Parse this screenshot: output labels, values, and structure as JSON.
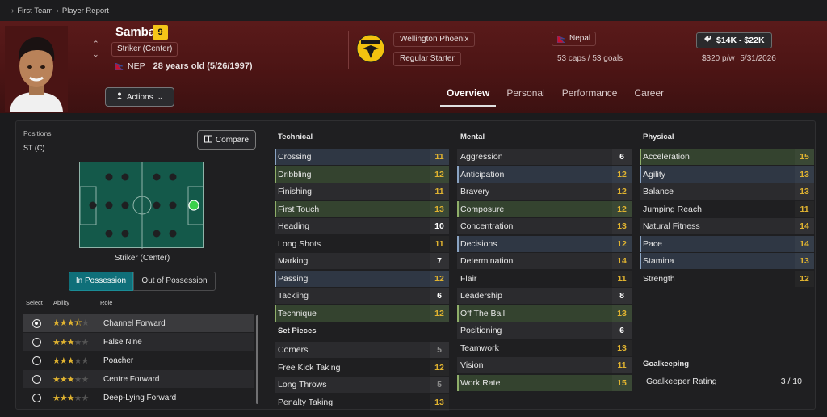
{
  "breadcrumb": {
    "items": [
      "First Team",
      "Player Report"
    ]
  },
  "player": {
    "name": "Samba",
    "number": "9",
    "position": "Striker (Center)",
    "nation_code": "NEP",
    "age_dob": "28 years old (5/26/1997)"
  },
  "club": {
    "name": "Wellington Phoenix",
    "status": "Regular Starter",
    "crest_text": "PHOENIX"
  },
  "nation": {
    "name": "Nepal",
    "caps": "53 caps / 53 goals"
  },
  "contract": {
    "value": "$14K - $22K",
    "wage": "$320 p/w",
    "expiry": "5/31/2026"
  },
  "actions_label": "Actions",
  "tabs": [
    "Overview",
    "Personal",
    "Performance",
    "Career"
  ],
  "left": {
    "positions_label": "Positions",
    "positions_value": "ST (C)",
    "compare_label": "Compare",
    "role_name": "Striker (Center)",
    "in_possession": "In Possession",
    "out_possession": "Out of Possession",
    "headers": {
      "select": "Select",
      "ability": "Ability",
      "role": "Role"
    },
    "roles": [
      {
        "name": "Channel Forward",
        "stars": 3.5,
        "selected": true
      },
      {
        "name": "False Nine",
        "stars": 3,
        "selected": false
      },
      {
        "name": "Poacher",
        "stars": 3,
        "selected": false
      },
      {
        "name": "Centre Forward",
        "stars": 3,
        "selected": false
      },
      {
        "name": "Deep-Lying Forward",
        "stars": 3,
        "selected": false
      }
    ]
  },
  "technical": {
    "title": "Technical",
    "attrs": [
      [
        "Crossing",
        "11"
      ],
      [
        "Dribbling",
        "12"
      ],
      [
        "Finishing",
        "11"
      ],
      [
        "First Touch",
        "13"
      ],
      [
        "Heading",
        "10"
      ],
      [
        "Long Shots",
        "11"
      ],
      [
        "Marking",
        "7"
      ],
      [
        "Passing",
        "12"
      ],
      [
        "Tackling",
        "6"
      ],
      [
        "Technique",
        "12"
      ]
    ]
  },
  "set_pieces": {
    "title": "Set Pieces",
    "attrs": [
      [
        "Corners",
        "5"
      ],
      [
        "Free Kick Taking",
        "12"
      ],
      [
        "Long Throws",
        "5"
      ],
      [
        "Penalty Taking",
        "13"
      ]
    ]
  },
  "mental": {
    "title": "Mental",
    "attrs": [
      [
        "Aggression",
        "6"
      ],
      [
        "Anticipation",
        "12"
      ],
      [
        "Bravery",
        "12"
      ],
      [
        "Composure",
        "12"
      ],
      [
        "Concentration",
        "13"
      ],
      [
        "Decisions",
        "12"
      ],
      [
        "Determination",
        "14"
      ],
      [
        "Flair",
        "11"
      ],
      [
        "Leadership",
        "8"
      ],
      [
        "Off The Ball",
        "13"
      ],
      [
        "Positioning",
        "6"
      ],
      [
        "Teamwork",
        "13"
      ],
      [
        "Vision",
        "11"
      ],
      [
        "Work Rate",
        "15"
      ]
    ]
  },
  "physical": {
    "title": "Physical",
    "attrs": [
      [
        "Acceleration",
        "15"
      ],
      [
        "Agility",
        "13"
      ],
      [
        "Balance",
        "13"
      ],
      [
        "Jumping Reach",
        "11"
      ],
      [
        "Natural Fitness",
        "14"
      ],
      [
        "Pace",
        "14"
      ],
      [
        "Stamina",
        "13"
      ],
      [
        "Strength",
        "12"
      ]
    ]
  },
  "goalkeeping": {
    "title": "Goalkeeping",
    "rating_label": "Goalkeeper Rating",
    "rating_value": "3 / 10"
  },
  "colors": {
    "hero_bg": "#4a1414",
    "accent_yellow": "#e0b330",
    "teal": "#0f6f79",
    "pitch": "#14594a"
  }
}
